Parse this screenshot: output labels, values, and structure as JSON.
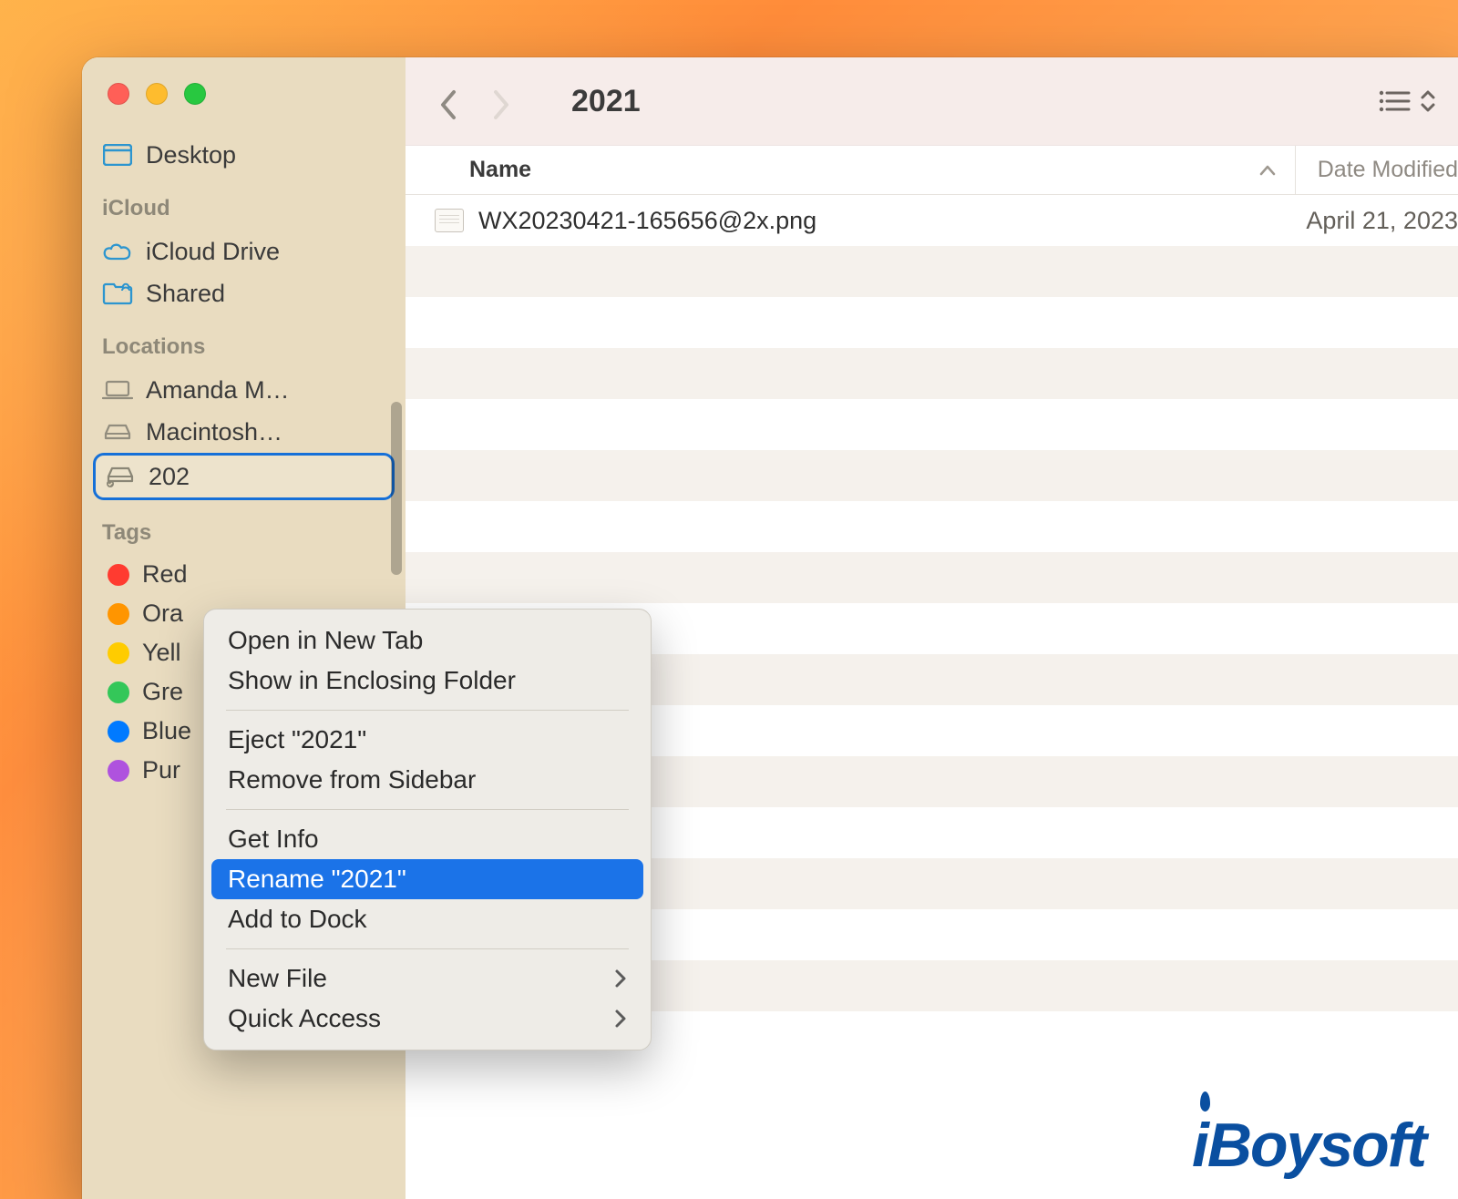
{
  "toolbar": {
    "title": "2021"
  },
  "columns": {
    "name": "Name",
    "date": "Date Modified"
  },
  "sidebar": {
    "favorites": {
      "desktop": "Desktop"
    },
    "icloud_section": "iCloud",
    "icloud": {
      "drive": "iCloud Drive",
      "shared": "Shared"
    },
    "locations_section": "Locations",
    "locations": {
      "amanda": "Amanda M…",
      "macintosh": "Macintosh…",
      "disk": "202"
    },
    "tags_section": "Tags",
    "tags": [
      {
        "label": "Red",
        "color": "#ff3b30"
      },
      {
        "label": "Ora",
        "color": "#ff9500"
      },
      {
        "label": "Yell",
        "color": "#ffcc00"
      },
      {
        "label": "Gre",
        "color": "#34c759"
      },
      {
        "label": "Blue",
        "color": "#007aff"
      },
      {
        "label": "Pur",
        "color": "#af52de"
      }
    ]
  },
  "files": [
    {
      "name": "WX20230421-165656@2x.png",
      "date": "April 21, 2023"
    }
  ],
  "context_menu": {
    "open_new_tab": "Open in New Tab",
    "show_enclosing": "Show in Enclosing Folder",
    "eject": "Eject \"2021\"",
    "remove_sidebar": "Remove from Sidebar",
    "get_info": "Get Info",
    "rename": "Rename \"2021\"",
    "add_dock": "Add to Dock",
    "new_file": "New File",
    "quick_access": "Quick Access"
  },
  "watermark": "iBoysoft"
}
